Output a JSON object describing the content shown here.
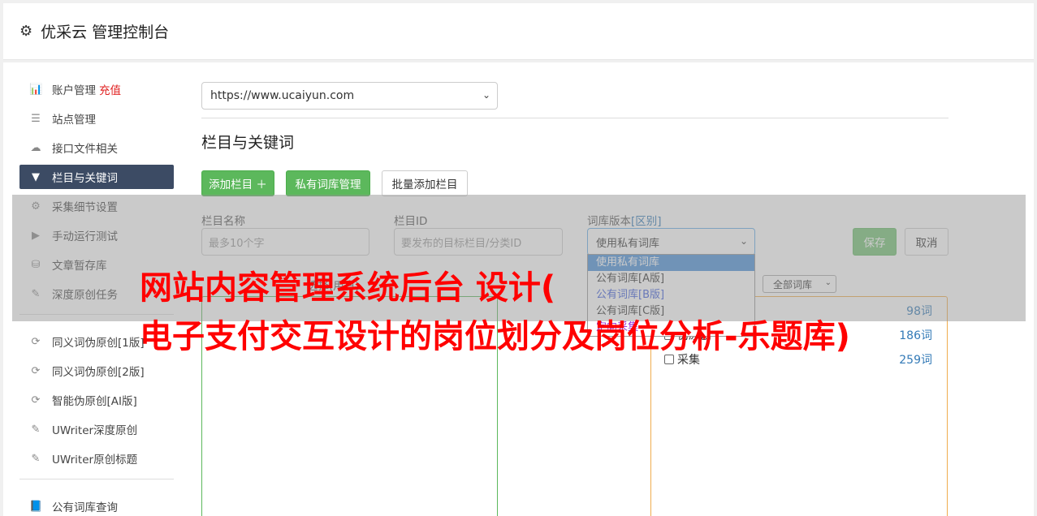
{
  "header": {
    "title": "优采云 管理控制台",
    "icon": "gear-icon"
  },
  "sidebar": {
    "items": [
      {
        "label": "账户管理",
        "accent": "充值",
        "icon": "bar-chart-icon",
        "glyph": "📊"
      },
      {
        "label": "站点管理",
        "icon": "server-icon",
        "glyph": "☰"
      },
      {
        "label": "接口文件相关",
        "icon": "cloud-upload-icon",
        "glyph": "☁"
      },
      {
        "label": "栏目与关键词",
        "icon": "filter-icon",
        "glyph": "▼",
        "active": true
      },
      {
        "label": "采集细节设置",
        "icon": "cogs-icon",
        "glyph": "⚙"
      },
      {
        "label": "手动运行测试",
        "icon": "play-icon",
        "glyph": "▶"
      },
      {
        "label": "文章暂存库",
        "icon": "database-icon",
        "glyph": "⛁"
      },
      {
        "label": "深度原创任务",
        "icon": "edit-icon",
        "glyph": "✎"
      }
    ],
    "items2": [
      {
        "label": "同义词伪原创[1版]",
        "icon": "refresh-icon",
        "glyph": "⟳"
      },
      {
        "label": "同义词伪原创[2版]",
        "icon": "refresh-icon",
        "glyph": "⟳"
      },
      {
        "label": "智能伪原创[AI版]",
        "icon": "refresh-icon",
        "glyph": "⟳"
      },
      {
        "label": "UWriter深度原创",
        "icon": "edit-icon",
        "glyph": "✎"
      },
      {
        "label": "UWriter原创标题",
        "icon": "edit-icon",
        "glyph": "✎"
      }
    ],
    "items3": [
      {
        "label": "公有词库查询",
        "icon": "book-icon",
        "glyph": "📘"
      }
    ]
  },
  "main": {
    "site_select": "https://www.ucaiyun.com",
    "section_title": "栏目与关键词",
    "buttons": {
      "add": "添加栏目 ＋",
      "private": "私有词库管理",
      "batch": "批量添加栏目"
    },
    "form": {
      "name_label": "栏目名称",
      "name_placeholder": "最多10个字",
      "id_label": "栏目ID",
      "id_placeholder": "要发布的目标栏目/分类ID",
      "ver_label": "词库版本",
      "ver_link": "[区别]",
      "ver_value": "使用私有词库",
      "save": "保存",
      "cancel": "取消"
    },
    "dropdown": [
      "使用私有词库",
      "公有词库[A版]",
      "公有词库[B版]",
      "公有词库[C版]",
      "定向采集"
    ],
    "sub_label": "选择(用户)",
    "lib_select": "全部词库",
    "libs": [
      {
        "label": "",
        "count": "98词"
      },
      {
        "label": "伪原创",
        "count": "186词"
      },
      {
        "label": "采集",
        "count": "259词"
      }
    ]
  },
  "watermark": {
    "line1": "网站内容管理系统后台 设计(",
    "line2": "电子支付交互设计的岗位划分及岗位分析-乐题库)"
  }
}
